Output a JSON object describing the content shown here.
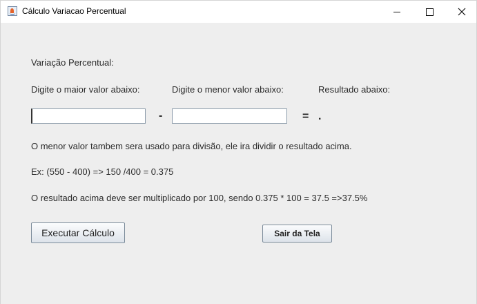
{
  "window": {
    "title": "Cálculo Variacao Percentual",
    "controls": {
      "minimize": "–",
      "maximize": "☐",
      "close": "✕"
    }
  },
  "form": {
    "heading": "Variação Percentual:",
    "label_max": "Digite o maior valor abaixo:",
    "label_min": "Digite o menor valor abaixo:",
    "label_result": "Resultado abaixo:",
    "input_max_value": "",
    "input_min_value": "",
    "minus_sign": "-",
    "equals_sign": "=",
    "result_value": ".",
    "info_line1": "O menor valor tambem sera usado para divisão, ele ira dividir o resultado acima.",
    "info_line2": "Ex: (550 - 400) => 150 /400 = 0.375",
    "info_line3": "O resultado acima deve ser multiplicado por 100, sendo 0.375 * 100 = 37.5 =>37.5%"
  },
  "buttons": {
    "execute": "Executar Cálculo",
    "exit": "Sair da Tela"
  }
}
